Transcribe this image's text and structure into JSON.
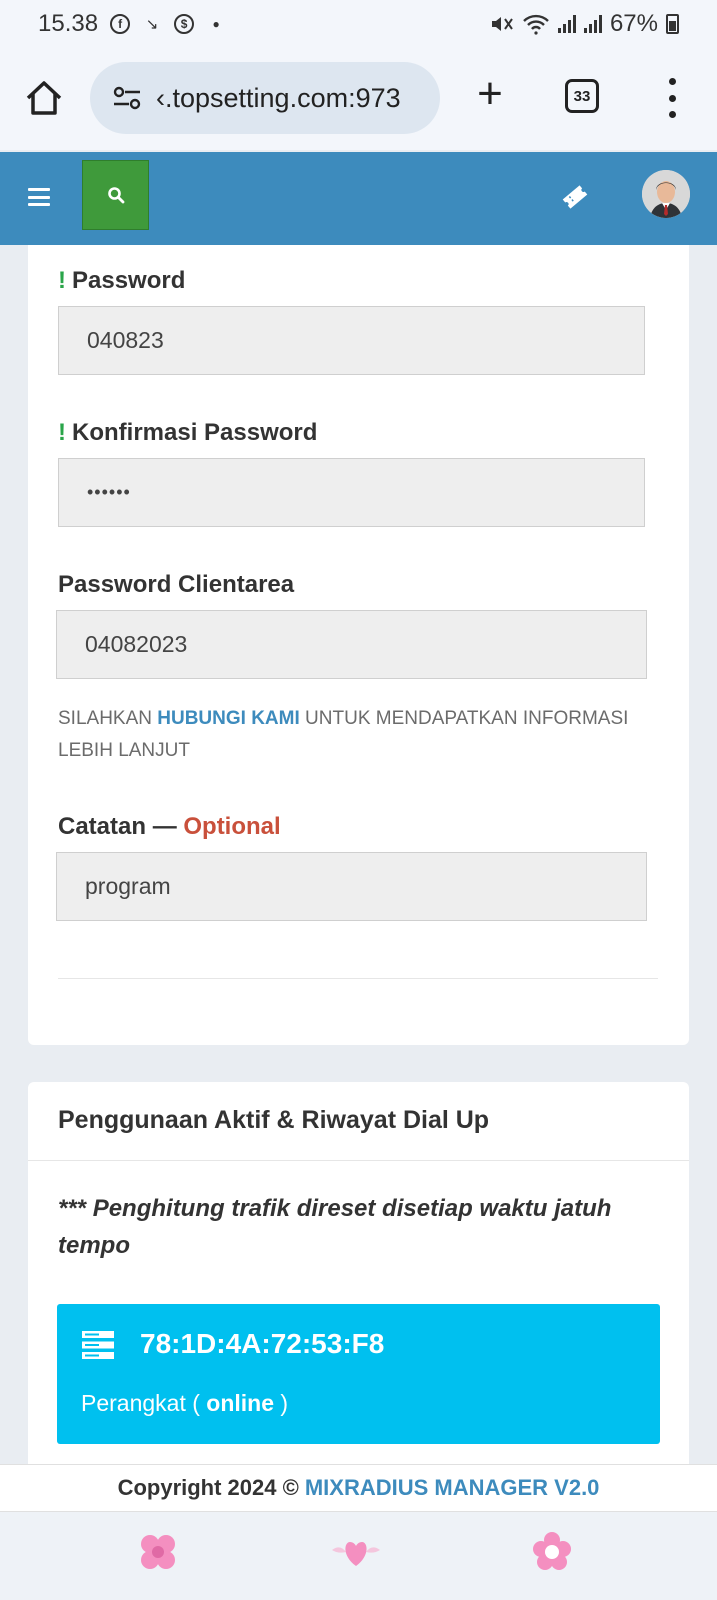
{
  "status_bar": {
    "time": "15.38",
    "battery": "67%",
    "notification_icons": [
      "facebook-icon",
      "missed-call-icon",
      "dollar-icon",
      "dot-icon"
    ]
  },
  "browser": {
    "url": "‹.topsetting.com:973",
    "tab_count": "33"
  },
  "form": {
    "password": {
      "label": "Password",
      "required_mark": "!",
      "value": "040823"
    },
    "confirm_password": {
      "label": "Konfirmasi Password",
      "required_mark": "!",
      "value": "••••••"
    },
    "clientarea_password": {
      "label": "Password Clientarea",
      "value": "04082023"
    },
    "help": {
      "prefix": "SILAHKAN ",
      "link": "HUBUNGI KAMI",
      "suffix": " UNTUK MENDAPATKAN INFORMASI LEBIH LANJUT"
    },
    "notes": {
      "label": "Catatan — ",
      "optional": "Optional",
      "value": "program"
    }
  },
  "usage": {
    "title": "Penggunaan Aktif & Riwayat Dial Up",
    "note": "*** Penghitung trafik direset disetiap waktu jatuh tempo",
    "device": {
      "mac": "78:1D:4A:72:53:F8",
      "status_prefix": "Perangkat ( ",
      "status_value": "online",
      "status_suffix": " )"
    }
  },
  "footer": {
    "copyright": "Copyright 2024 ©",
    "brand": "MIXRADIUS MANAGER V2.0"
  },
  "colors": {
    "header": "#3d8bbd",
    "search_button": "#3f9a3b",
    "device_box": "#00c0ef",
    "required": "#2aa54a",
    "optional": "#c9503b"
  }
}
